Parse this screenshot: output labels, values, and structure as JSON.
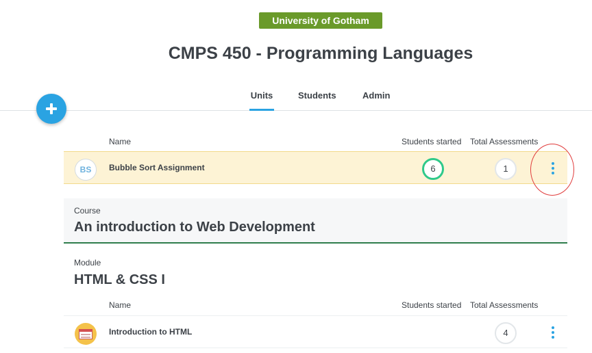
{
  "header": {
    "institution": "University of Gotham",
    "course_title": "CMPS 450 - Programming Languages"
  },
  "tabs": [
    {
      "label": "Units",
      "active": true
    },
    {
      "label": "Students",
      "active": false
    },
    {
      "label": "Admin",
      "active": false
    }
  ],
  "fab": {
    "icon": "plus-icon"
  },
  "columns": {
    "name": "Name",
    "students_started": "Students started",
    "total_assessments": "Total Assessments"
  },
  "units": [
    {
      "avatar": "BS",
      "name": "Bubble Sort Assignment",
      "students_started": "6",
      "total_assessments": "1",
      "highlighted": true
    }
  ],
  "course": {
    "label": "Course",
    "title": "An introduction to Web Development",
    "module": {
      "label": "Module",
      "title": "HTML & CSS I",
      "units": [
        {
          "icon": "browser-window-icon",
          "name": "Introduction to HTML",
          "total_assessments": "4"
        }
      ]
    }
  },
  "colors": {
    "accent": "#2aa3e2",
    "badge": "#6a9a2a",
    "highlight_row": "#fdf3d5",
    "progress_ring": "#2fc98a",
    "annotation_circle": "#e03b3b"
  }
}
